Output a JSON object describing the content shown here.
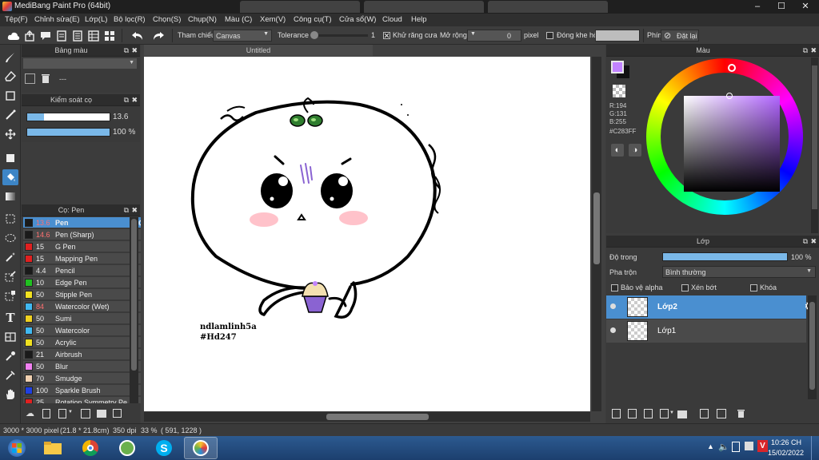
{
  "window": {
    "title": "MediBang Paint Pro (64bit)"
  },
  "menu": [
    "Tệp(F)",
    "Chỉnh sửa(E)",
    "Lớp(L)",
    "Bộ lọc(R)",
    "Chọn(S)",
    "Chụp(N)",
    "Màu (C)",
    "Xem(V)",
    "Công cụ(T)",
    "Cửa sổ(W)",
    "Cloud",
    "Help"
  ],
  "toolbar": {
    "reference_label": "Tham chiếu",
    "reference_value": "Canvas",
    "tolerance_label": "Tolerance",
    "tolerance_value": "1",
    "antialias_label": "Khử răng cưa",
    "expand_label": "Mở rộng",
    "expand_value": "0",
    "expand_unit": "pixel",
    "closegap_label": "Đóng khe hở",
    "key_label": "Phím",
    "reset_label": "Đặt lại"
  },
  "palette_panel": {
    "title": "Bảng màu",
    "value": "---"
  },
  "brush_control_panel": {
    "title": "Kiểm soát cọ",
    "size": "13.6",
    "opacity": "100 %",
    "size_level": 0.2,
    "opacity_level": 1.0
  },
  "brush_panel": {
    "title": "Cọ: Pen",
    "brushes": [
      {
        "size": "13.6",
        "name": "Pen",
        "color": "#1a1a1a",
        "selected": true,
        "size_red": true
      },
      {
        "size": "14.6",
        "name": "Pen (Sharp)",
        "color": "#1a1a1a",
        "size_red": true
      },
      {
        "size": "15",
        "name": "G Pen",
        "color": "#e02020"
      },
      {
        "size": "15",
        "name": "Mapping Pen",
        "color": "#e02020"
      },
      {
        "size": "4.4",
        "name": "Pencil",
        "color": "#1a1a1a"
      },
      {
        "size": "10",
        "name": "Edge Pen",
        "color": "#20c020"
      },
      {
        "size": "50",
        "name": "Stipple Pen",
        "color": "#f0e020"
      },
      {
        "size": "84",
        "name": "Watercolor (Wet)",
        "color": "#40b8f0",
        "size_red": true
      },
      {
        "size": "50",
        "name": "Sumi",
        "color": "#f0d020"
      },
      {
        "size": "50",
        "name": "Watercolor",
        "color": "#40b8f0"
      },
      {
        "size": "50",
        "name": "Acrylic",
        "color": "#f0e020"
      },
      {
        "size": "21",
        "name": "Airbrush",
        "color": "#1a1a1a"
      },
      {
        "size": "50",
        "name": "Blur",
        "color": "#f080f0"
      },
      {
        "size": "70",
        "name": "Smudge",
        "color": "#f0d0b0"
      },
      {
        "size": "100",
        "name": "Sparkle Brush",
        "color": "#2040e0"
      },
      {
        "size": "25",
        "name": "Rotation Symmetry Pe",
        "color": "#e02020"
      }
    ]
  },
  "document": {
    "tab": "Untitled",
    "signature_line1": "ndlamlinh5a",
    "signature_line2": "#Hd247"
  },
  "color_panel": {
    "title": "Màu",
    "r": "R:194",
    "g": "G:131",
    "b": "B:255",
    "hex": "#C283FF",
    "current_color": "#c283ff"
  },
  "layer_panel": {
    "title": "Lớp",
    "opacity_label": "Độ trong",
    "opacity_value": "100 %",
    "opacity_level": 1.0,
    "blend_label": "Pha trộn",
    "blend_value": "Bình thường",
    "protect_alpha": "Bảo vệ alpha",
    "clipping": "Xén bớt",
    "lock": "Khóa",
    "layers": [
      {
        "name": "Lớp2",
        "selected": true
      },
      {
        "name": "Lớp1",
        "selected": false
      }
    ]
  },
  "status": {
    "size": "3000 * 3000 pixel",
    "cm": "(21.8 * 21.8cm)",
    "dpi": "350 dpi",
    "zoom": "33 %",
    "coords": "( 591, 1228 )"
  },
  "taskbar": {
    "time": "10:26 CH",
    "date": "15/02/2022"
  }
}
